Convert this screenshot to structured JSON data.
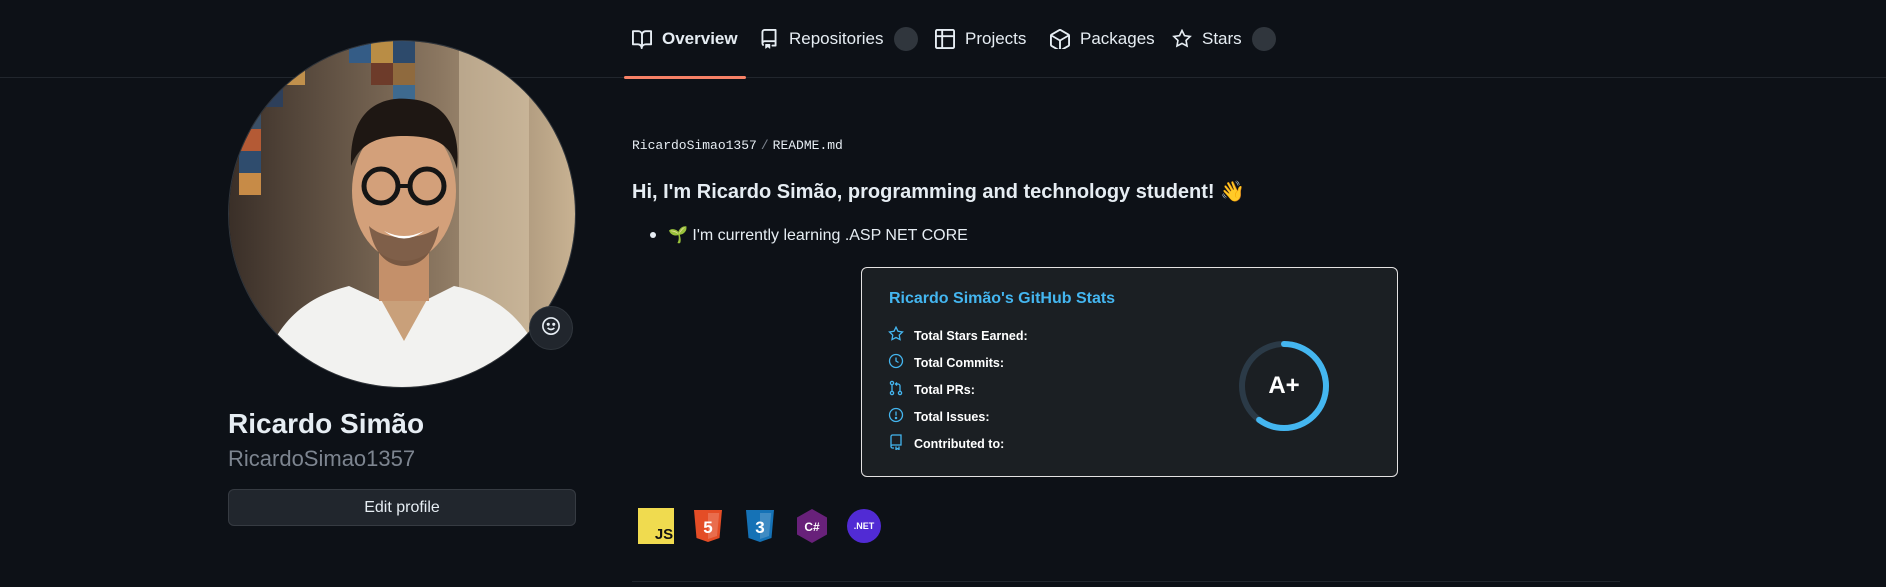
{
  "nav": {
    "tabs": [
      {
        "label": "Overview",
        "icon": "book-icon",
        "active": true
      },
      {
        "label": "Repositories",
        "icon": "repo-icon",
        "active": false
      },
      {
        "label": "Projects",
        "icon": "table-icon",
        "active": false
      },
      {
        "label": "Packages",
        "icon": "package-icon",
        "active": false
      },
      {
        "label": "Stars",
        "icon": "star-icon",
        "active": false
      }
    ]
  },
  "profile": {
    "name": "Ricardo Simão",
    "username": "RicardoSimao1357",
    "edit_label": "Edit profile"
  },
  "readme": {
    "owner": "RicardoSimao1357",
    "file": "README.md",
    "heading": "Hi, I'm Ricardo Simão, programming and technology student! 👋",
    "bullet": "🌱 I'm currently learning .ASP NET CORE"
  },
  "stats_card": {
    "title": "Ricardo Simão's GitHub Stats",
    "rows": [
      {
        "label": "Total Stars Earned:",
        "icon": "star-icon"
      },
      {
        "label": "Total Commits:",
        "icon": "history-icon"
      },
      {
        "label": "Total PRs:",
        "icon": "pull-request-icon"
      },
      {
        "label": "Total Issues:",
        "icon": "issue-icon"
      },
      {
        "label": "Contributed to:",
        "icon": "repo-icon"
      }
    ],
    "rank": "A+",
    "accent": "#44b6f0",
    "rank_progress": 0.6
  },
  "tech_icons": [
    {
      "name": "javascript-icon",
      "text": "JS",
      "color": "#f0db4f"
    },
    {
      "name": "html5-icon",
      "text": "5",
      "color": "#e44d26"
    },
    {
      "name": "css3-icon",
      "text": "3",
      "color": "#1572b6"
    },
    {
      "name": "csharp-icon",
      "text": "C#",
      "color": "#68217a"
    },
    {
      "name": "dotnet-icon",
      "text": ".NET",
      "color": "#512bd4"
    }
  ],
  "colors": {
    "background": "#0d1117",
    "tab_underline": "#f78166",
    "muted": "#7d8590"
  }
}
